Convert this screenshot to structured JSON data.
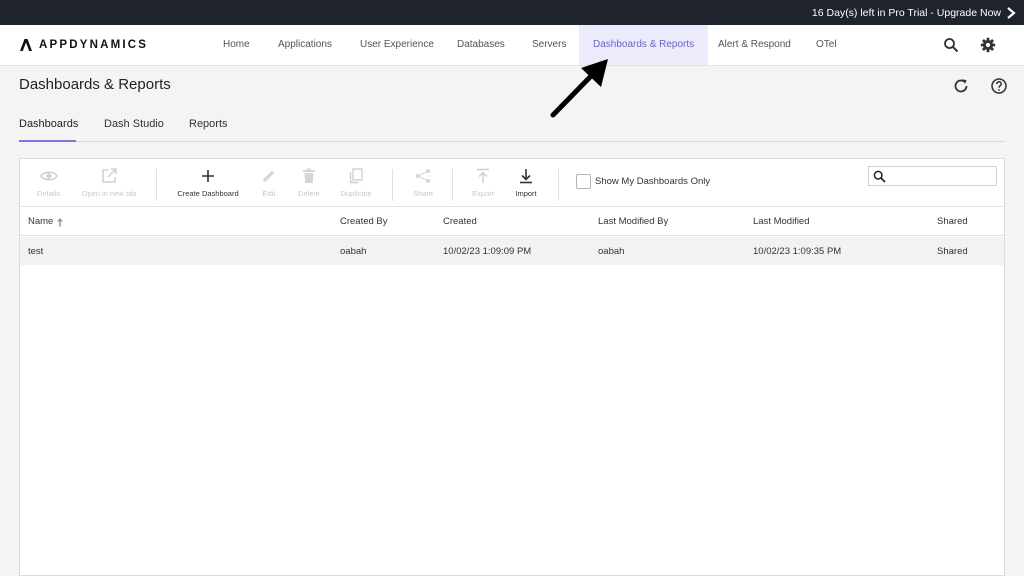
{
  "trial_banner": {
    "text": "16 Day(s) left in Pro Trial - Upgrade Now",
    "icon": "chevron-right-icon"
  },
  "brand": {
    "name": "APPDYNAMICS",
    "accent": "#6b61d8"
  },
  "nav": {
    "items": [
      {
        "label": "Home"
      },
      {
        "label": "Applications"
      },
      {
        "label": "User Experience"
      },
      {
        "label": "Databases"
      },
      {
        "label": "Servers"
      },
      {
        "label": "Dashboards & Reports",
        "active": true
      },
      {
        "label": "Alert & Respond"
      },
      {
        "label": "OTel"
      }
    ],
    "icons": [
      "search-icon",
      "gear-icon"
    ]
  },
  "page": {
    "title": "Dashboards & Reports",
    "header_icons": [
      "refresh-icon",
      "help-icon"
    ]
  },
  "tabs": [
    {
      "label": "Dashboards",
      "active": true
    },
    {
      "label": "Dash Studio"
    },
    {
      "label": "Reports"
    }
  ],
  "toolbar": {
    "details": "Details",
    "open_new_tab": "Open in new tab",
    "create_dashboard": "Create Dashboard",
    "edit": "Edit",
    "delete": "Delete",
    "duplicate": "Duplicate",
    "share": "Share",
    "export": "Export",
    "import": "Import",
    "show_mine_only": "Show My Dashboards Only",
    "search_value": ""
  },
  "table": {
    "columns": [
      "Name",
      "Created By",
      "Created",
      "Last Modified By",
      "Last Modified",
      "Shared"
    ],
    "sort": {
      "column": "Name",
      "direction": "ascending"
    },
    "rows": [
      [
        "test",
        "oabah",
        "10/02/23 1:09:09 PM",
        "oabah",
        "10/02/23 1:09:35 PM",
        "Shared"
      ]
    ]
  }
}
